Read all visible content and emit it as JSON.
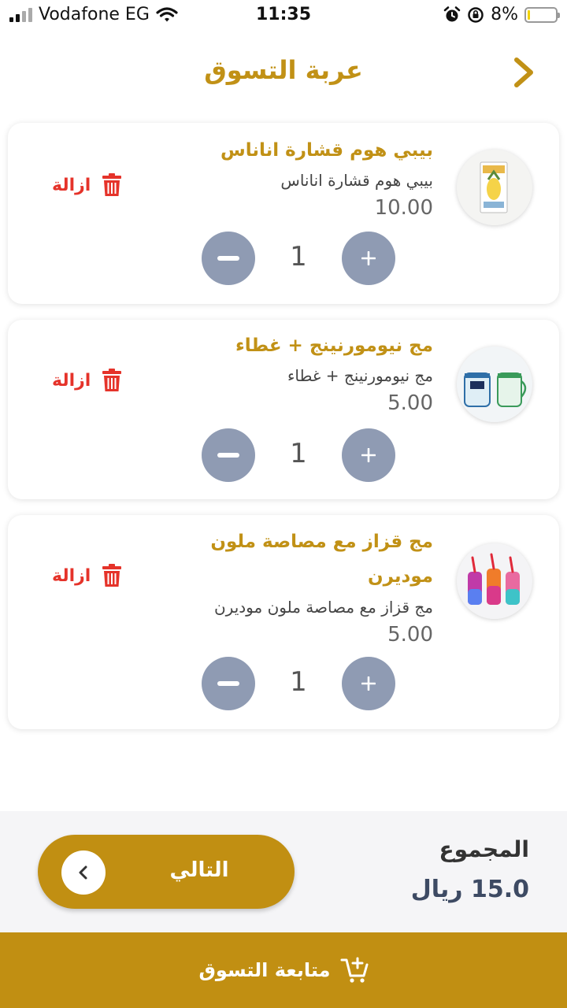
{
  "status_bar": {
    "carrier": "Vodafone EG",
    "time": "11:35",
    "battery_percent": "8%",
    "battery_level": 0.08
  },
  "header": {
    "title": "عربة التسوق"
  },
  "cart": {
    "items": [
      {
        "title": "بيبي هوم قشارة اناناس",
        "subtitle": "بيبي هوم قشارة اناناس",
        "price": "10.00",
        "quantity": "1",
        "remove_label": "ازالة",
        "image_icon": "pineapple-peeler-product-image"
      },
      {
        "title": "مج نيومورنينج + غطاء",
        "subtitle": "مج نيومورنينج + غطاء",
        "price": "5.00",
        "quantity": "1",
        "remove_label": "ازالة",
        "image_icon": "glass-mug-product-image"
      },
      {
        "title": "مج قزاز مع مصاصة ملون موديرن",
        "subtitle": "مج قزاز مع مصاصة ملون موديرن",
        "price": "5.00",
        "quantity": "1",
        "remove_label": "ازالة",
        "image_icon": "colored-bottles-product-image"
      }
    ]
  },
  "summary": {
    "total_label": "المجموع",
    "total_value": "15.0 ريال",
    "next_label": "التالي"
  },
  "footer": {
    "continue_label": "متابعة التسوق"
  },
  "colors": {
    "accent": "#c18f12",
    "title_gold": "#c19116",
    "remove_red": "#e5332a",
    "qty_button": "#8f9bb3",
    "total_text": "#3d4a63"
  }
}
